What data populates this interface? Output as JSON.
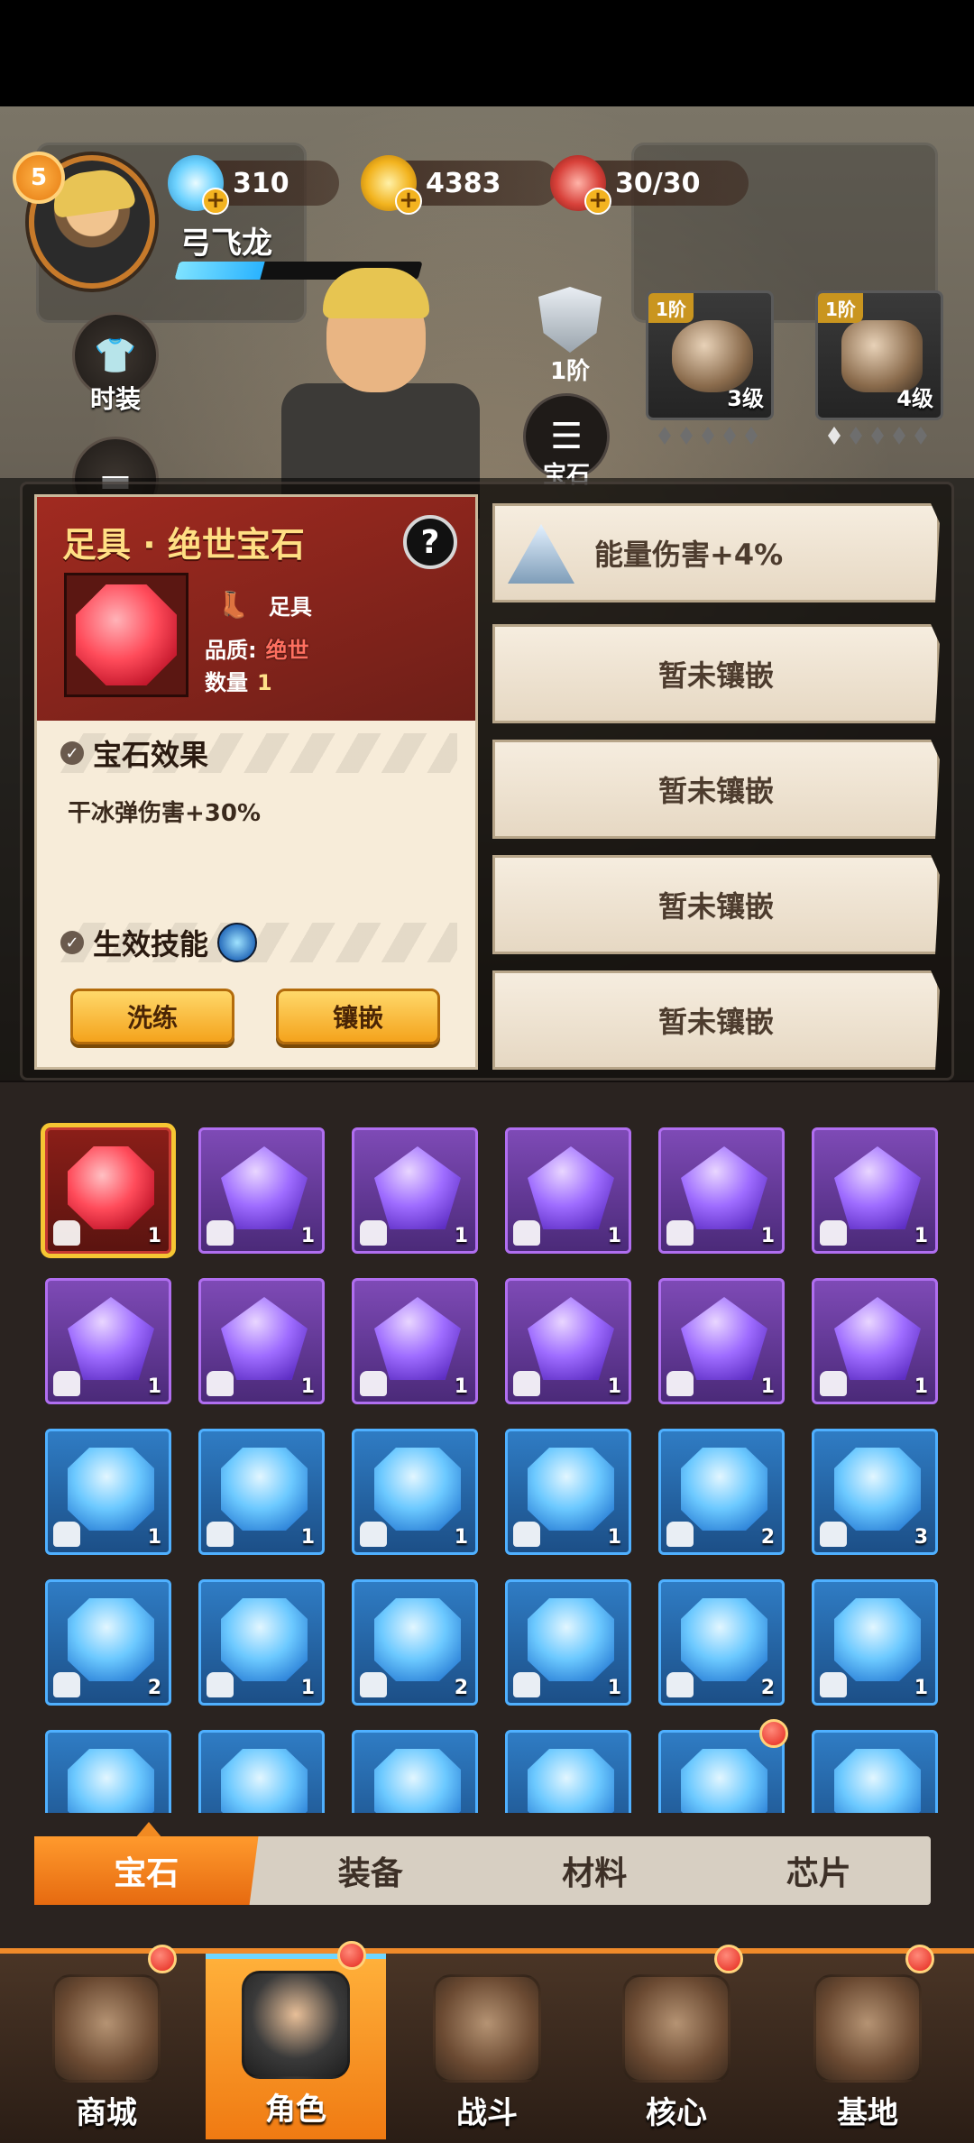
{
  "player": {
    "level": "5",
    "name": "弓飞龙",
    "exp_fraction": 0.35
  },
  "resources": {
    "diamonds": "310",
    "gold": "4383",
    "stamina": "30/30"
  },
  "side_buttons": {
    "costume": "时装"
  },
  "gear": {
    "rank_label": "1阶",
    "gem_menu_label": "宝石",
    "items": [
      {
        "tier": "1阶",
        "level": "3级",
        "slots_filled": 0
      },
      {
        "tier": "1阶",
        "level": "4级",
        "slots_filled": 1
      }
    ]
  },
  "gem_detail": {
    "title": "足具 · 绝世宝石",
    "help": "?",
    "slot_label": "足具",
    "quality_label": "品质:",
    "quality_value": "绝世",
    "quantity_label": "数量",
    "quantity_value": "1",
    "effect_title": "宝石效果",
    "effect_text": "干冰弹伤害+30%",
    "skill_title": "生效技能",
    "reroll_button": "洗练",
    "inlay_button": "镶嵌"
  },
  "sockets": [
    {
      "text": "能量伤害+4%",
      "filled": true
    },
    {
      "text": "暂未镶嵌",
      "filled": false
    },
    {
      "text": "暂未镶嵌",
      "filled": false
    },
    {
      "text": "暂未镶嵌",
      "filled": false
    },
    {
      "text": "暂未镶嵌",
      "filled": false
    }
  ],
  "inventory": [
    {
      "color": "red",
      "qty": "1",
      "selected": true
    },
    {
      "color": "purple",
      "qty": "1"
    },
    {
      "color": "purple",
      "qty": "1"
    },
    {
      "color": "purple",
      "qty": "1"
    },
    {
      "color": "purple",
      "qty": "1"
    },
    {
      "color": "purple",
      "qty": "1"
    },
    {
      "color": "purple",
      "qty": "1"
    },
    {
      "color": "purple",
      "qty": "1"
    },
    {
      "color": "purple",
      "qty": "1"
    },
    {
      "color": "purple",
      "qty": "1"
    },
    {
      "color": "purple",
      "qty": "1"
    },
    {
      "color": "purple",
      "qty": "1"
    },
    {
      "color": "blue",
      "qty": "1"
    },
    {
      "color": "blue",
      "qty": "1"
    },
    {
      "color": "blue",
      "qty": "1"
    },
    {
      "color": "blue",
      "qty": "1"
    },
    {
      "color": "blue",
      "qty": "2"
    },
    {
      "color": "blue",
      "qty": "3"
    },
    {
      "color": "blue",
      "qty": "2"
    },
    {
      "color": "blue",
      "qty": "1"
    },
    {
      "color": "blue",
      "qty": "2"
    },
    {
      "color": "blue",
      "qty": "1"
    },
    {
      "color": "blue",
      "qty": "2"
    },
    {
      "color": "blue",
      "qty": "1"
    },
    {
      "color": "blue",
      "qty": ""
    },
    {
      "color": "blue",
      "qty": ""
    },
    {
      "color": "blue",
      "qty": ""
    },
    {
      "color": "blue",
      "qty": ""
    },
    {
      "color": "blue",
      "qty": "",
      "notify": true
    },
    {
      "color": "blue",
      "qty": ""
    }
  ],
  "category_tabs": [
    "宝石",
    "装备",
    "材料",
    "芯片"
  ],
  "bottom_nav": [
    "商城",
    "角色",
    "战斗",
    "核心",
    "基地"
  ]
}
